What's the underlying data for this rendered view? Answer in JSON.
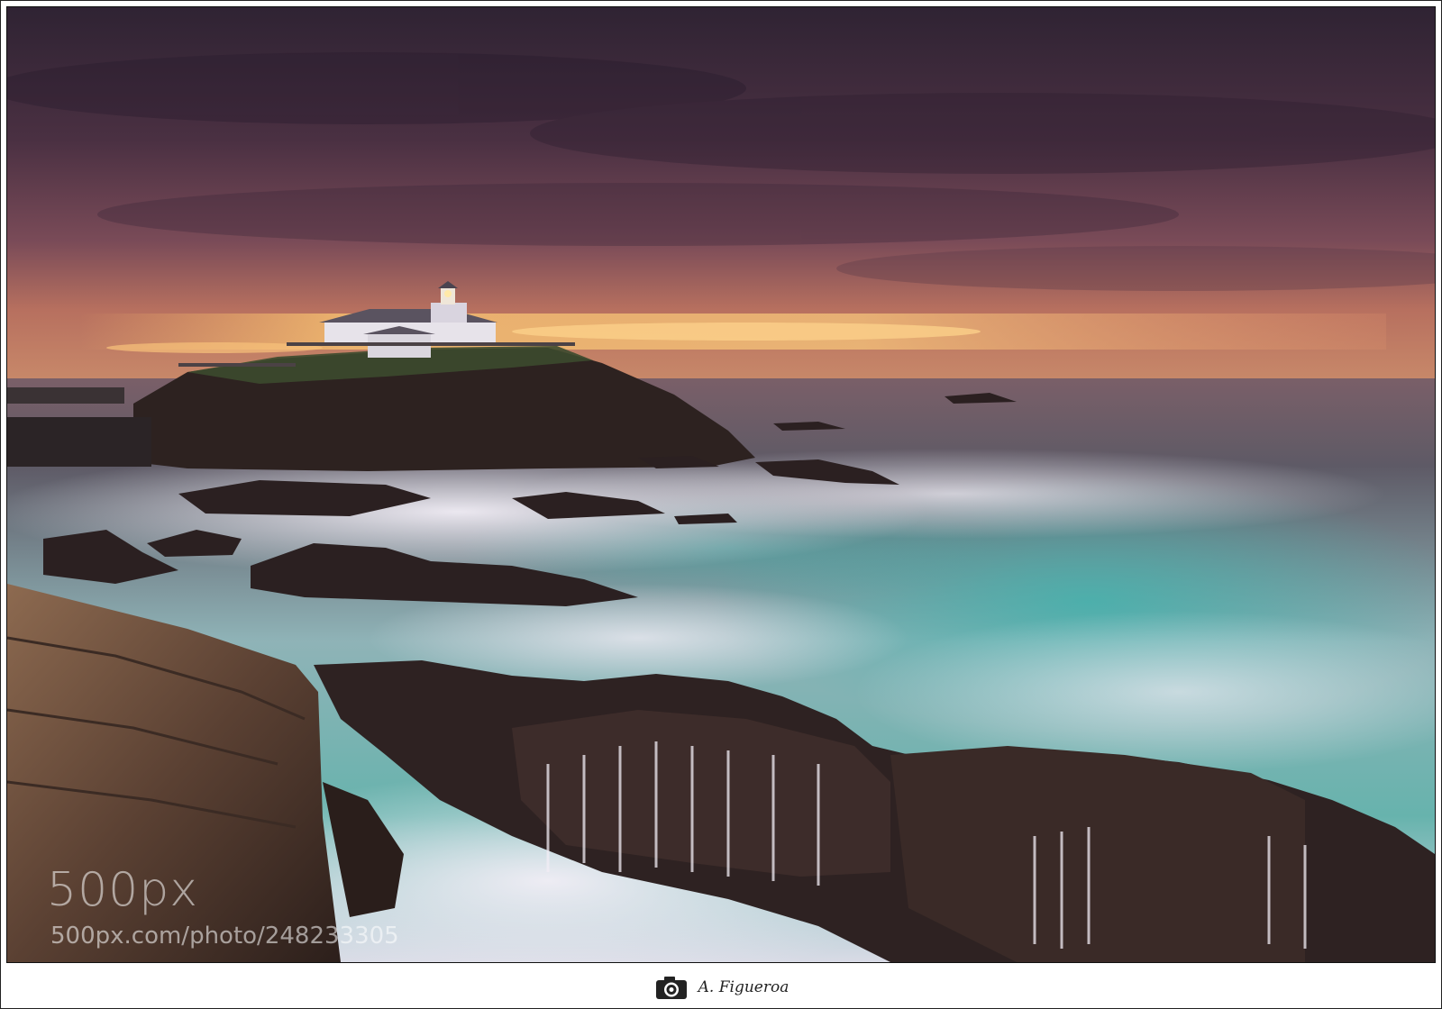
{
  "photo": {
    "subject": "lighthouse on rocky headland at sunset with long-exposure waves",
    "palette": {
      "sky_top": "#3a2a3c",
      "sky_mid": "#6e4656",
      "horizon_glow": "#f0a860",
      "sea": "#6fa7a6",
      "foam": "#e9e3ee",
      "rock": "#3a2a28"
    }
  },
  "watermark": {
    "logo": "500px",
    "url": "500px.com/photo/248233305"
  },
  "signature": {
    "icon": "camera-icon",
    "text": "A. Figueroa"
  }
}
